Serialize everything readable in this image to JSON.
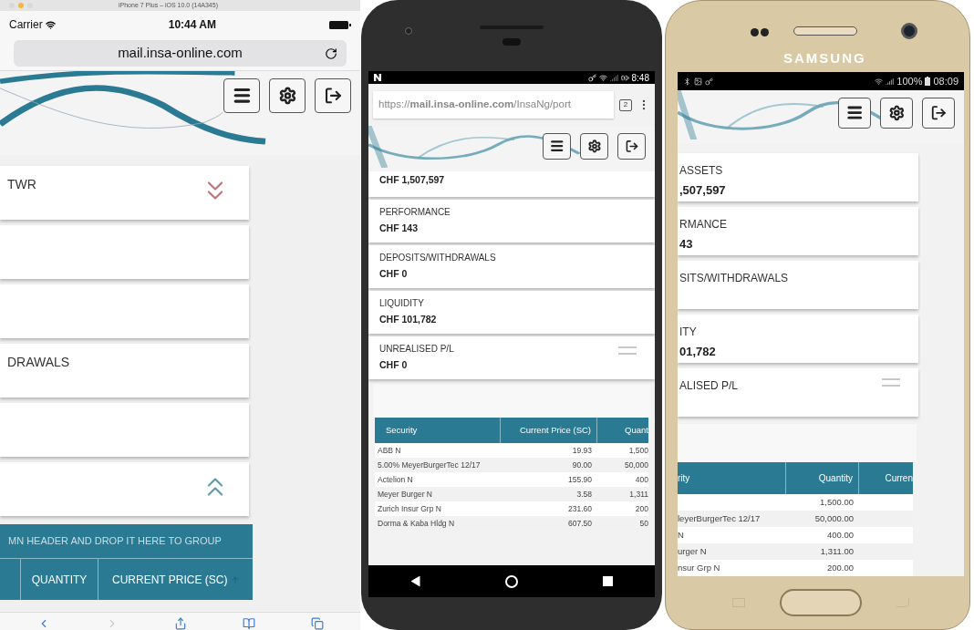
{
  "simulator": {
    "title": "iPhone 7 Plus – iOS 10.0 (14A345)",
    "carrier": "Carrier",
    "time": "10:44 AM",
    "url": "mail.insa-online.com",
    "cards": [
      {
        "label": "TWR",
        "kind": "toggle",
        "expanded": false
      },
      {
        "kind": "plain"
      },
      {
        "kind": "plain"
      },
      {
        "label": "DRAWALS",
        "kind": "plain"
      },
      {
        "kind": "plain"
      },
      {
        "kind": "toggle",
        "expanded": true
      }
    ],
    "group_hint": "MN HEADER AND DROP IT HERE TO GROUP",
    "columns": [
      "QUANTITY",
      "CURRENT PRICE (SC)"
    ]
  },
  "android": {
    "time": "8:48",
    "url": "https://**mail.insa-online.com**/InsaNg/port",
    "tab_count": "2",
    "cards": [
      {
        "value": "CHF 1,507,597",
        "kind": "plain"
      },
      {
        "label": "PERFORMANCE",
        "value": "CHF 143",
        "kind": "plain"
      },
      {
        "label": "DEPOSITS/WITHDRAWALS",
        "value": "CHF 0",
        "kind": "plain"
      },
      {
        "label": "LIQUIDITY",
        "value": "CHF 101,782",
        "kind": "plain"
      },
      {
        "label": "UNREALISED P/L",
        "value": "CHF 0",
        "kind": "handle"
      }
    ],
    "columns": [
      "Security",
      "Current Price (SC)",
      "Quant"
    ],
    "rows": [
      {
        "security": "ABB N",
        "price": "19.93",
        "quantity": "1,500"
      },
      {
        "security": "5.00% MeyerBurgerTec 12/17",
        "price": "90.00",
        "quantity": "50,000"
      },
      {
        "security": "Actelion N",
        "price": "155.90",
        "quantity": "400"
      },
      {
        "security": "Meyer Burger N",
        "price": "3.58",
        "quantity": "1,311"
      },
      {
        "security": "Zurich Insur Grp N",
        "price": "231.60",
        "quantity": "200"
      },
      {
        "security": "Dorma & Kaba Hldg N",
        "price": "607.50",
        "quantity": "50"
      }
    ]
  },
  "samsung": {
    "brand": "SAMSUNG",
    "battery": "100%",
    "time": "08:09",
    "cards": [
      {
        "label": "ASSETS",
        "value": ",507,597",
        "kind": "plain"
      },
      {
        "label": "RMANCE",
        "value": "43",
        "kind": "plain"
      },
      {
        "label": "SITS/WITHDRAWALS",
        "kind": "plain"
      },
      {
        "label": "ITY",
        "value": "01,782",
        "kind": "plain"
      },
      {
        "label": "ALISED P/L",
        "kind": "handle"
      }
    ],
    "columns": [
      "rity",
      "Quantity",
      "Curren"
    ],
    "rows": [
      {
        "quantity": "1,500.00"
      },
      {
        "security": "leyerBurgerTec 12/17",
        "quantity": "50,000.00"
      },
      {
        "security": "N",
        "quantity": "400.00"
      },
      {
        "security": "urger N",
        "quantity": "1,311.00"
      },
      {
        "security": "nsur Grp N",
        "quantity": "200.00"
      }
    ]
  }
}
